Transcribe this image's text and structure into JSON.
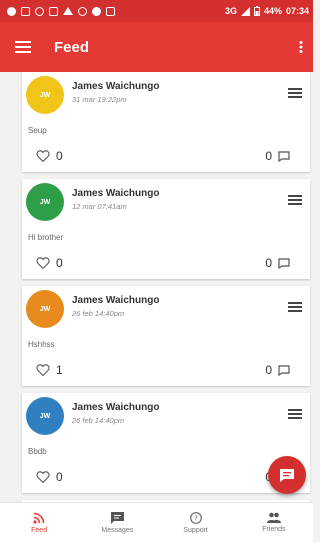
{
  "status_bar": {
    "network": "3G",
    "battery": "44%",
    "time": "07:34"
  },
  "app_bar": {
    "title": "Feed",
    "menu_icon": "hamburger-menu-icon",
    "more_icon": "more-vert-icon"
  },
  "colors": {
    "primary": "#e53935",
    "status_bar": "#d32f2f",
    "avatar_yellow": "#f0c419",
    "avatar_green": "#2e9e48",
    "avatar_orange": "#e98a1f",
    "avatar_blue": "#2f7fc1"
  },
  "posts": [
    {
      "initials": "JW",
      "author": "James Waichungo",
      "time": "31 mar 19:22pm",
      "text": "Seup",
      "likes": "0",
      "comments": "0"
    },
    {
      "initials": "JW",
      "author": "James Waichungo",
      "time": "12 mar 07:41am",
      "text": "Hi brother",
      "likes": "0",
      "comments": "0"
    },
    {
      "initials": "JW",
      "author": "James Waichungo",
      "time": "26 feb 14:40pm",
      "text": "Hshhss",
      "likes": "1",
      "comments": "0"
    },
    {
      "initials": "JW",
      "author": "James Waichungo",
      "time": "26 feb 14:40pm",
      "text": "Bbdb",
      "likes": "0",
      "comments": "0"
    }
  ],
  "fab": {
    "icon": "chat-bubble-icon"
  },
  "bottom_nav": [
    {
      "label": "Feed",
      "icon": "rss-feed-icon"
    },
    {
      "label": "Messages",
      "icon": "message-icon"
    },
    {
      "label": "Support",
      "icon": "help-icon"
    },
    {
      "label": "Friends",
      "icon": "people-icon"
    }
  ]
}
